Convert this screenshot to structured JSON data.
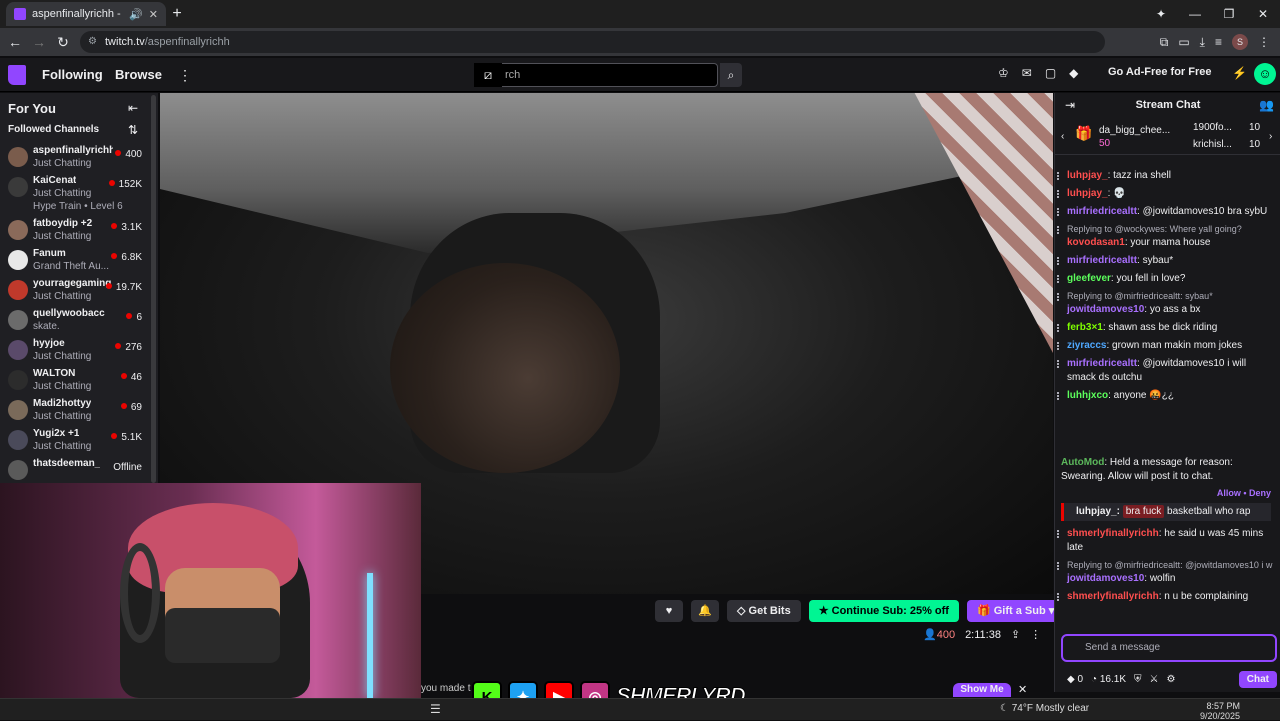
{
  "browser": {
    "tab_title": "aspenfinallyrichh - Twitch",
    "url_domain": "twitch.tv",
    "url_path": "/aspenfinallyrichh",
    "profile_initial": "S"
  },
  "twitch_nav": {
    "following": "Following",
    "browse": "Browse",
    "search_placeholder": "Search",
    "search_visible": "rch",
    "ad_free": "Go Ad-Free for Free"
  },
  "sidebar": {
    "title": "For You",
    "section": "Followed Channels",
    "channels": [
      {
        "name": "aspenfinallyrichh",
        "sub": "Just Chatting",
        "count": "400",
        "color": "#7a5c4c"
      },
      {
        "name": "KaiCenat",
        "sub": "Just Chatting",
        "extra": "Hype Train • Level 6",
        "count": "152K",
        "color": "#3a3a3a"
      },
      {
        "name": "fatboydip +2",
        "sub": "Just Chatting",
        "count": "3.1K",
        "color": "#8a6a5a"
      },
      {
        "name": "Fanum",
        "sub": "Grand Theft Au...",
        "count": "6.8K",
        "color": "#e8e8e8"
      },
      {
        "name": "yourragegaming",
        "sub": "Just Chatting",
        "count": "19.7K",
        "color": "#c0392b"
      },
      {
        "name": "quellywoobacc",
        "sub": "skate.",
        "count": "6",
        "color": "#6b6b6b"
      },
      {
        "name": "hyyjoe",
        "sub": "Just Chatting",
        "count": "276",
        "color": "#5a4a6a"
      },
      {
        "name": "WALTON",
        "sub": "Just Chatting",
        "count": "46",
        "color": "#2c2c2c"
      },
      {
        "name": "Madi2hottyy",
        "sub": "Just Chatting",
        "count": "69",
        "color": "#7a6a5a"
      },
      {
        "name": "Yugi2x +1",
        "sub": "Just Chatting",
        "count": "5.1K",
        "color": "#4a4a5a"
      },
      {
        "name": "thatsdeeman_",
        "sub": "",
        "count": "Offline",
        "color": "#5a5a5a"
      }
    ]
  },
  "player": {
    "get_bits": "Get Bits",
    "continue_sub": "Continue Sub: 25% off",
    "gift_sub": "Gift a Sub",
    "viewers": "400",
    "uptime": "2:11:38",
    "banner_text": "you made t",
    "show_me": "Show Me",
    "overlay_text": "SHMERLYRD"
  },
  "chat": {
    "title": "Stream Chat",
    "leaderboard": {
      "gifter": "da_bigg_chee...",
      "gifter_count": "50",
      "u1": "1900fo...",
      "u1_count": "10",
      "u2": "krichisl...",
      "u2_count": "10"
    },
    "messages": [
      {
        "user": "luhpjay_",
        "color": "#ff4f4f",
        "text": ": tazz ina shell"
      },
      {
        "user": "luhpjay_",
        "color": "#ff4f4f",
        "text": ": 💀"
      },
      {
        "user": "mirfriedricealtt",
        "color": "#a970ff",
        "text": ": @jowitdamoves10 bra sybU",
        "mention": true
      },
      {
        "reply": "Replying to @wockywes: Where yall going?",
        "user": "kovodasan1",
        "color": "#ff4f4f",
        "text": ": your mama house"
      },
      {
        "user": "mirfriedricealtt",
        "color": "#a970ff",
        "text": ": sybau*"
      },
      {
        "user": "gleefever",
        "color": "#5cff5c",
        "text": ": you fell in love?"
      },
      {
        "reply": "Replying to @mirfriedricealtt: sybau*",
        "user": "jowitdamoves10",
        "color": "#a970ff",
        "text": ": yo ass a bx"
      },
      {
        "user": "ferb3×1",
        "color": "#7fff00",
        "text": ": shawn ass be dick riding"
      },
      {
        "user": "ziyraccs",
        "color": "#4fa8ff",
        "text": ": grown man makin mom jokes"
      },
      {
        "user": "mirfriedricealtt",
        "color": "#a970ff",
        "text": ": @jowitdamoves10 i will smack ds outchu"
      },
      {
        "user": "luhhjxco",
        "color": "#5cff5c",
        "text": ": anyone 🤬¿¿"
      }
    ],
    "automod": {
      "label": "AutoMod",
      "text": ": Held a message for reason: Swearing. Allow will post it to chat.",
      "allow": "Allow",
      "deny": "Deny",
      "flag_user": "luhpjay_:",
      "flag_word": "bra fuck",
      "flag_rest": "basketball who rap"
    },
    "messages2": [
      {
        "user": "shmerlyfinallyrichh",
        "color": "#ff4f4f",
        "text": ": he said u was 45 mins late"
      },
      {
        "reply": "Replying to @mirfriedricealtt: @jowitdamoves10 i w",
        "user": "jowitdamoves10",
        "color": "#a970ff",
        "text": ": wolfin"
      },
      {
        "user": "shmerlyfinallyrichh",
        "color": "#ff4f4f",
        "text": ": n u be complaining"
      }
    ],
    "input_placeholder": "Send a message",
    "footer": {
      "bits": "0",
      "points": "16.1K",
      "chat_button": "Chat"
    }
  },
  "taskbar": {
    "temp": "74°F",
    "weather": "Mostly clear",
    "time": "8:57 PM",
    "date": "9/20/2025"
  }
}
